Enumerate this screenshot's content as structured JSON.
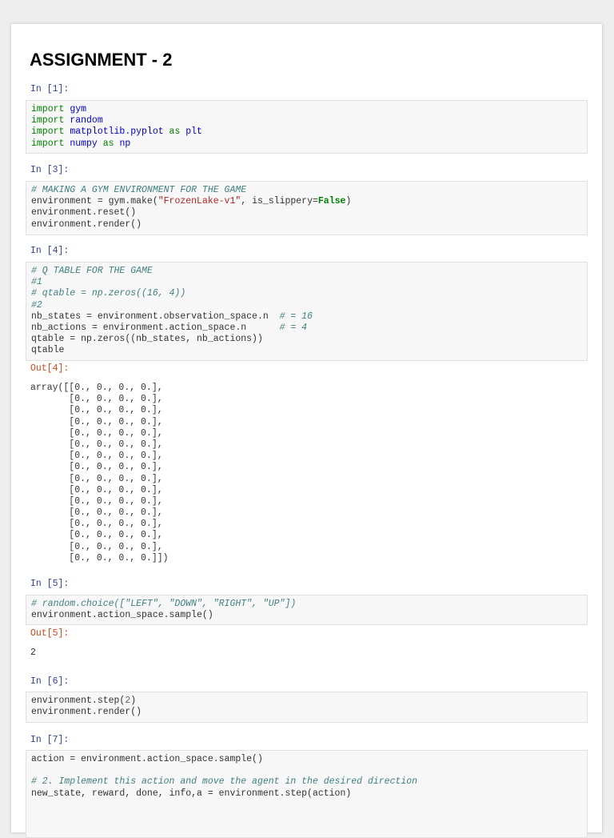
{
  "title": "ASSIGNMENT - 2",
  "cells": [
    {
      "prompt": "In [1]:",
      "lines": [
        [
          [
            "import ",
            "kw"
          ],
          [
            "gym",
            "nm"
          ]
        ],
        [
          [
            "import ",
            "kw"
          ],
          [
            "random",
            "nm"
          ]
        ],
        [
          [
            "import ",
            "kw"
          ],
          [
            "matplotlib.pyplot",
            "nm"
          ],
          [
            " as ",
            "kw"
          ],
          [
            "plt",
            "nm"
          ]
        ],
        [
          [
            "import ",
            "kw"
          ],
          [
            "numpy",
            "nm"
          ],
          [
            " as ",
            "kw"
          ],
          [
            "np",
            "nm"
          ]
        ]
      ]
    },
    {
      "prompt": "In [3]:",
      "lines": [
        [
          [
            "# MAKING A GYM ENVIRONMENT FOR THE GAME",
            "cm"
          ]
        ],
        [
          [
            "environment = gym.make(",
            ""
          ],
          [
            "\"FrozenLake-v1\"",
            "st"
          ],
          [
            ", is_slippery=",
            ""
          ],
          [
            "False",
            "bk"
          ],
          [
            ")",
            ""
          ]
        ],
        [
          [
            "environment.reset()",
            ""
          ]
        ],
        [
          [
            "environment.render()",
            ""
          ]
        ]
      ]
    },
    {
      "prompt": "In [4]:",
      "lines": [
        [
          [
            "# Q TABLE FOR THE GAME",
            "cm"
          ]
        ],
        [
          [
            "#1",
            "cm"
          ]
        ],
        [
          [
            "# qtable = np.zeros((16, 4))",
            "cm"
          ]
        ],
        [
          [
            "#2",
            "cm"
          ]
        ],
        [
          [
            "nb_states = environment.observation_space.n  ",
            ""
          ],
          [
            "# = 16",
            "cm"
          ]
        ],
        [
          [
            "nb_actions = environment.action_space.n      ",
            ""
          ],
          [
            "# = 4",
            "cm"
          ]
        ],
        [
          [
            "qtable = np.zeros((nb_states, nb_actions))",
            ""
          ]
        ],
        [
          [
            "qtable",
            ""
          ]
        ]
      ],
      "out_prompt": "Out[4]:",
      "output": [
        "array([[0., 0., 0., 0.],",
        "       [0., 0., 0., 0.],",
        "       [0., 0., 0., 0.],",
        "       [0., 0., 0., 0.],",
        "       [0., 0., 0., 0.],",
        "       [0., 0., 0., 0.],",
        "       [0., 0., 0., 0.],",
        "       [0., 0., 0., 0.],",
        "       [0., 0., 0., 0.],",
        "       [0., 0., 0., 0.],",
        "       [0., 0., 0., 0.],",
        "       [0., 0., 0., 0.],",
        "       [0., 0., 0., 0.],",
        "       [0., 0., 0., 0.],",
        "       [0., 0., 0., 0.],",
        "       [0., 0., 0., 0.]])"
      ]
    },
    {
      "prompt": "In [5]:",
      "lines": [
        [
          [
            "# random.choice([\"LEFT\", \"DOWN\", \"RIGHT\", \"UP\"])",
            "cm"
          ]
        ],
        [
          [
            "environment.action_space.sample()",
            ""
          ]
        ]
      ],
      "out_prompt": "Out[5]:",
      "output": [
        "2"
      ]
    },
    {
      "prompt": "In [6]:",
      "lines": [
        [
          [
            "environment.step(",
            ""
          ],
          [
            "2",
            "num"
          ],
          [
            ")",
            ""
          ]
        ],
        [
          [
            "environment.render()",
            ""
          ]
        ]
      ]
    },
    {
      "prompt": "In [7]:",
      "lines": [
        [
          [
            "action = environment.action_space.sample()",
            ""
          ]
        ],
        [
          [
            "",
            ""
          ]
        ],
        [
          [
            "# 2. Implement this action and move the agent in the desired direction",
            "cm"
          ]
        ],
        [
          [
            "new_state, reward, done, info,a = environment.step(action)",
            ""
          ]
        ]
      ]
    }
  ]
}
